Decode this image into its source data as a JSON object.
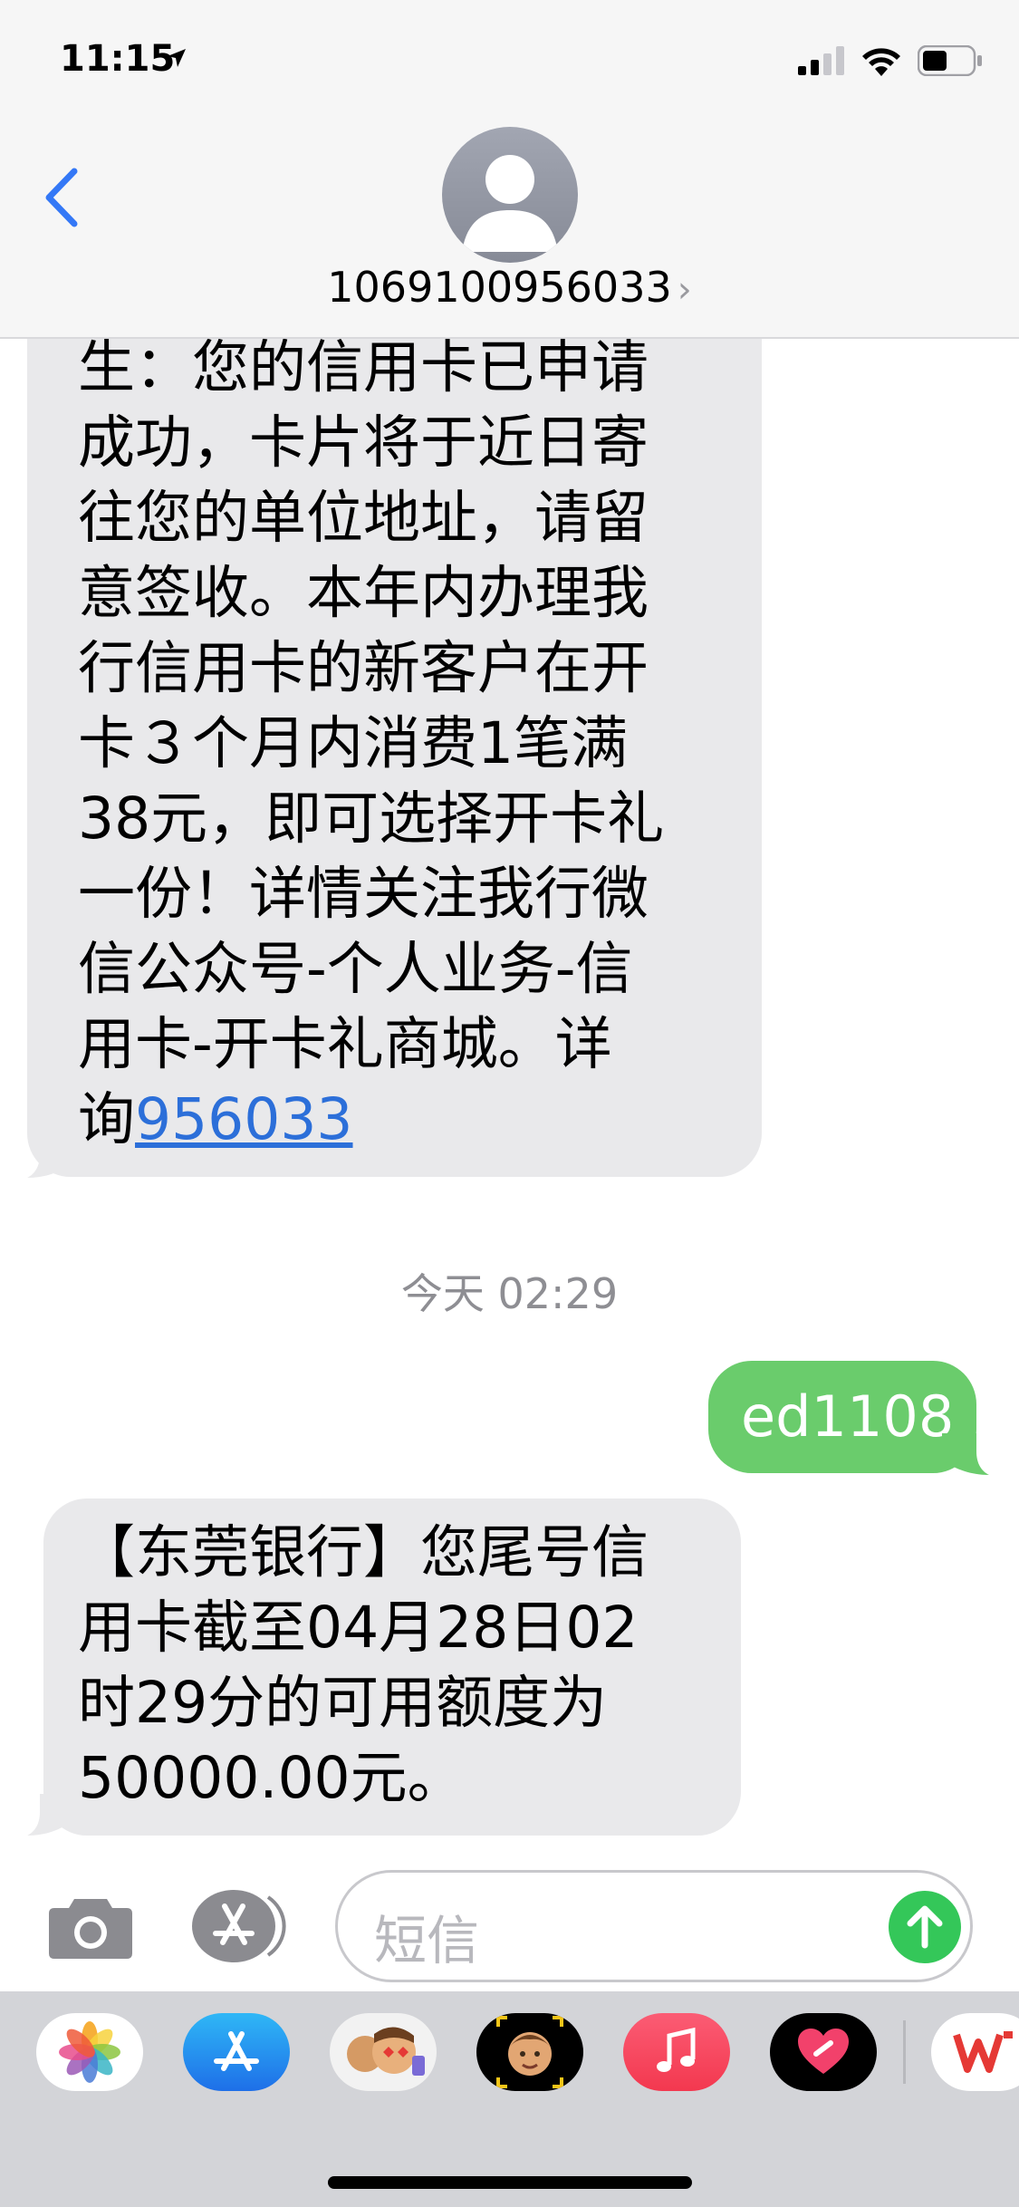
{
  "status_bar": {
    "time": "11:15"
  },
  "header": {
    "contact": "1069100956033"
  },
  "messages": {
    "m1_text": "生：您的信用卡已申请\n成功，卡片将于近日寄\n往您的单位地址，请留\n意签收。本年内办理我\n行信用卡的新客户在开\n卡３个月内消费1笔满\n38元，即可选择开卡礼\n一份！详情关注我行微\n信公众号-个人业务-信\n用卡-开卡礼商城。详\n询",
    "m1_link": "956033",
    "timestamp": "今天 02:29",
    "m2_text": "ed1108",
    "m3_text": "【东莞银行】您尾号信\n用卡截至04月28日02\n时29分的可用额度为\n50000.00元。"
  },
  "input": {
    "placeholder": "短信"
  },
  "colors": {
    "incoming": "#e9e9eb",
    "outgoing": "#6acc6c",
    "send": "#34c759",
    "link": "#2c6fd9",
    "back": "#3478f6"
  },
  "drawer_apps": [
    "photos-icon",
    "app-store-icon",
    "memoji-stickers-icon",
    "animoji-icon",
    "music-icon",
    "fitness-heart-icon",
    "wps-office-icon"
  ]
}
